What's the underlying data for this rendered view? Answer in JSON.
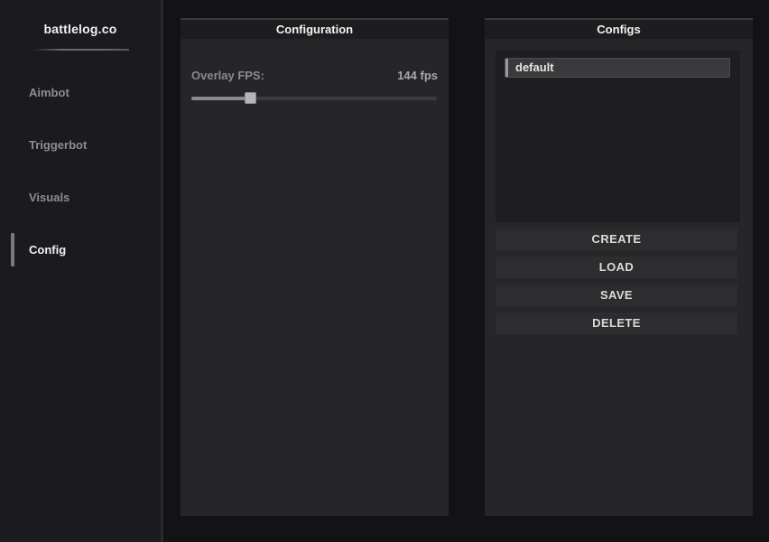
{
  "sidebar": {
    "brand": "battlelog.co",
    "items": [
      {
        "label": "Aimbot"
      },
      {
        "label": "Triggerbot"
      },
      {
        "label": "Visuals"
      },
      {
        "label": "Config",
        "active": true
      }
    ]
  },
  "configuration_panel": {
    "title": "Configuration",
    "overlay_fps": {
      "label": "Overlay FPS:",
      "value_text": "144 fps",
      "slider_fraction": 0.24
    }
  },
  "configs_panel": {
    "title": "Configs",
    "list": [
      {
        "name": "default",
        "selected": true
      }
    ],
    "buttons": {
      "create": "CREATE",
      "load": "LOAD",
      "save": "SAVE",
      "delete": "DELETE"
    }
  },
  "colors": {
    "background": "#131315",
    "sidebar": "#1b1b1f",
    "panel": "#262628",
    "panel_header": "#1d1d1f",
    "accent": "#9a9a9e"
  }
}
